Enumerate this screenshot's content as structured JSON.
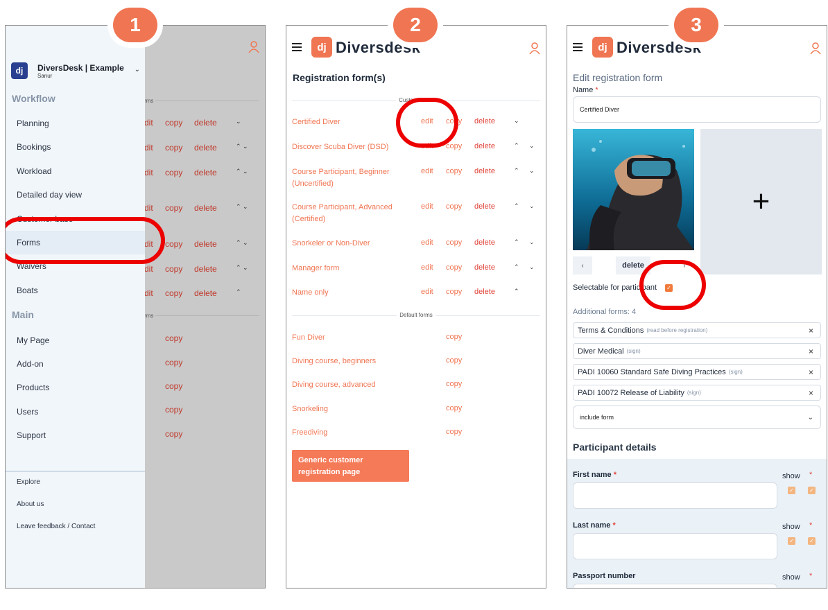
{
  "steps": [
    "1",
    "2",
    "3"
  ],
  "panel1": {
    "org": {
      "logo": "dj",
      "name": "DiversDesk | Example",
      "location": "Sanur"
    },
    "sections": {
      "workflow": "Workflow",
      "main": "Main"
    },
    "workflow_items": [
      "Planning",
      "Bookings",
      "Workload",
      "Detailed day view",
      "Customer base",
      "Forms",
      "Waivers",
      "Boats"
    ],
    "main_items": [
      "My Page",
      "Add-on",
      "Products",
      "Users",
      "Support"
    ],
    "footer_items": [
      "Explore",
      "About us",
      "Leave feedback / Contact"
    ],
    "bg": {
      "edit": "dit",
      "copy": "copy",
      "delete": "delete",
      "sep": "rms"
    }
  },
  "panel2": {
    "brand": "Diversdesk",
    "brand_logo": "dj",
    "title": "Registration form(s)",
    "custom_forms_label": "Custom forms",
    "default_forms_label": "Default forms",
    "actions": {
      "edit": "edit",
      "copy": "copy",
      "delete": "delete"
    },
    "custom_forms": [
      "Certified Diver",
      "Discover Scuba Diver (DSD)",
      "Course Participant, Beginner (Uncertified)",
      "Course Participant, Advanced (Certified)",
      "Snorkeler or Non-Diver",
      "Manager form",
      "Name only"
    ],
    "default_forms": [
      "Fun Diver",
      "Diving course, beginners",
      "Diving course, advanced",
      "Snorkeling",
      "Freediving"
    ],
    "generic_button": "Generic customer registration page"
  },
  "panel3": {
    "brand": "Diversdesk",
    "brand_logo": "dj",
    "title": "Edit registration form",
    "name_label": "Name",
    "required_mark": "*",
    "name_value": "Certified Diver",
    "delete_label": "delete",
    "add_symbol": "+",
    "selectable_label": "Selectable for participant",
    "additional_forms_label": "Additional forms: 4",
    "additional_forms": [
      {
        "name": "Terms & Conditions",
        "note": "(read before registration)"
      },
      {
        "name": "Diver Medical",
        "note": "(sign)"
      },
      {
        "name": "PADI 10060 Standard Safe Diving Practices",
        "note": "(sign)"
      },
      {
        "name": "PADI 10072 Release of Liability",
        "note": "(sign)"
      }
    ],
    "include_form_label": "include form",
    "participant_details_title": "Participant details",
    "fields": [
      "First name",
      "Last name",
      "Passport number"
    ],
    "show_label": "show"
  },
  "colors": {
    "accent": "#f07552",
    "highlight": "#ec0000",
    "nav_logo": "#2a3f8f"
  }
}
